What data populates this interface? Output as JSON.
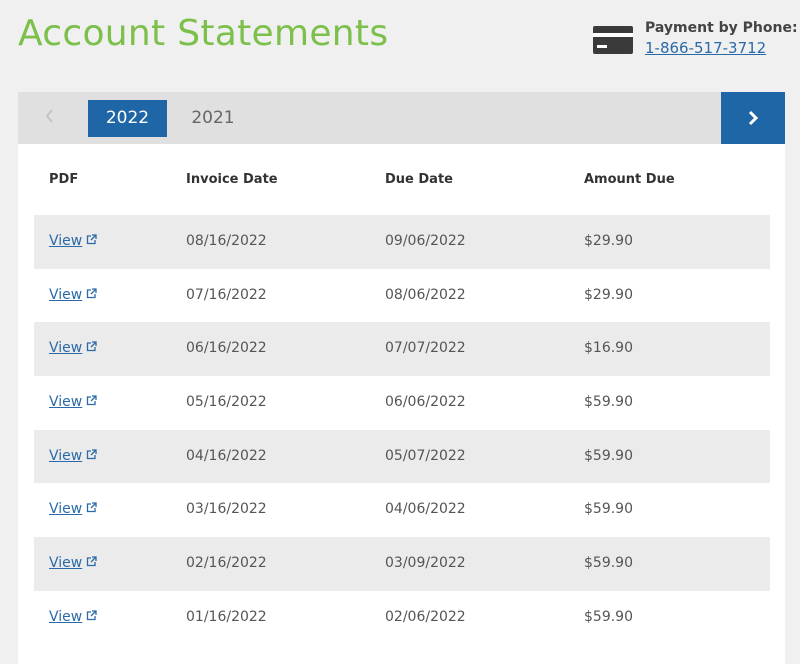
{
  "header": {
    "title": "Account Statements",
    "payment_label": "Payment by Phone:",
    "payment_phone": "1-866-517-3712",
    "payment_icon": "credit-card-icon"
  },
  "year_nav": {
    "prev_icon": "chevron-left-icon",
    "next_icon": "chevron-right-icon",
    "years": [
      "2022",
      "2021"
    ],
    "selected": "2022"
  },
  "table": {
    "columns": [
      "PDF",
      "Invoice Date",
      "Due Date",
      "Amount Due"
    ],
    "rows": [
      {
        "pdf": "View",
        "invoice_date": "08/16/2022",
        "due_date": "09/06/2022",
        "amount_due": "$29.90"
      },
      {
        "pdf": "View",
        "invoice_date": "07/16/2022",
        "due_date": "08/06/2022",
        "amount_due": "$29.90"
      },
      {
        "pdf": "View",
        "invoice_date": "06/16/2022",
        "due_date": "07/07/2022",
        "amount_due": "$16.90"
      },
      {
        "pdf": "View",
        "invoice_date": "05/16/2022",
        "due_date": "06/06/2022",
        "amount_due": "$59.90"
      },
      {
        "pdf": "View",
        "invoice_date": "04/16/2022",
        "due_date": "05/07/2022",
        "amount_due": "$59.90"
      },
      {
        "pdf": "View",
        "invoice_date": "03/16/2022",
        "due_date": "04/06/2022",
        "amount_due": "$59.90"
      },
      {
        "pdf": "View",
        "invoice_date": "02/16/2022",
        "due_date": "03/09/2022",
        "amount_due": "$59.90"
      },
      {
        "pdf": "View",
        "invoice_date": "01/16/2022",
        "due_date": "02/06/2022",
        "amount_due": "$59.90"
      }
    ]
  },
  "colors": {
    "title_green": "#7cc04b",
    "accent_blue": "#1f66a6",
    "link_blue": "#2a6aa8"
  }
}
